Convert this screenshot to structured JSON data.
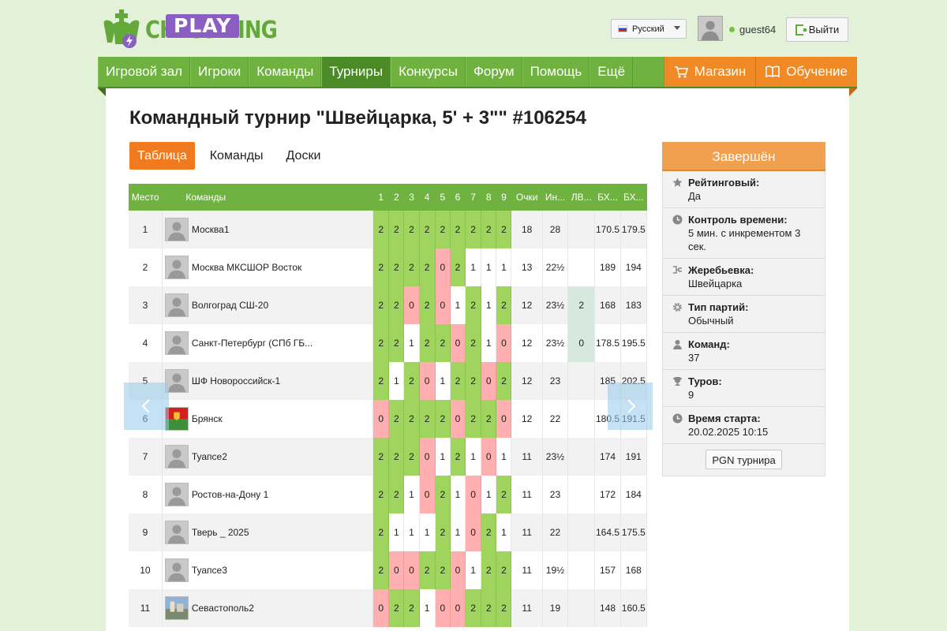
{
  "brand": {
    "name": "CHESS KING",
    "badge": "PLAY"
  },
  "header": {
    "language": "Русский",
    "username": "guest64",
    "logout_label": "Выйти"
  },
  "nav": {
    "items": [
      "Игровой зал",
      "Игроки",
      "Команды",
      "Турниры",
      "Конкурсы",
      "Форум",
      "Помощь",
      "Ещё"
    ],
    "active": "Турниры",
    "shop_label": "Магазин",
    "learn_label": "Обучение"
  },
  "page": {
    "title": "Командный турнир \"Швейцарка, 5' + 3\"\" #106254",
    "tabs": [
      "Таблица",
      "Команды",
      "Доски"
    ],
    "active_tab": "Таблица"
  },
  "table": {
    "headers": {
      "place": "Место",
      "teams": "Команды",
      "rounds": [
        "1",
        "2",
        "3",
        "4",
        "5",
        "6",
        "7",
        "8",
        "9"
      ],
      "points": "Очки",
      "ind": "Ин...",
      "lv": "ЛВ...",
      "bh1": "БХ...",
      "bh2": "БХ..."
    },
    "rows": [
      {
        "place": "1",
        "name": "Москва1",
        "avatar": "default",
        "results": [
          "2",
          "2",
          "2",
          "2",
          "2",
          "2",
          "2",
          "2",
          "2"
        ],
        "points": "18",
        "ind": "28",
        "lv": "",
        "bh1": "170.5",
        "bh2": "179.5"
      },
      {
        "place": "2",
        "name": "Москва МКСШОР Восток",
        "avatar": "default",
        "results": [
          "2",
          "2",
          "2",
          "2",
          "0",
          "2",
          "1",
          "1",
          "1"
        ],
        "points": "13",
        "ind": "22½",
        "lv": "",
        "bh1": "189",
        "bh2": "194"
      },
      {
        "place": "3",
        "name": "Волгоград СШ-20",
        "avatar": "default",
        "results": [
          "2",
          "2",
          "0",
          "2",
          "0",
          "1",
          "2",
          "1",
          "2"
        ],
        "points": "12",
        "ind": "23½",
        "lv": "2",
        "bh1": "168",
        "bh2": "183"
      },
      {
        "place": "4",
        "name": "Санкт-Петербург (СПб ГБ...",
        "avatar": "default",
        "results": [
          "2",
          "2",
          "1",
          "2",
          "2",
          "0",
          "2",
          "1",
          "0"
        ],
        "points": "12",
        "ind": "23½",
        "lv": "0",
        "bh1": "178.5",
        "bh2": "195.5"
      },
      {
        "place": "5",
        "name": "ШФ Новороссийск-1",
        "avatar": "default",
        "results": [
          "2",
          "1",
          "2",
          "0",
          "1",
          "2",
          "2",
          "0",
          "2"
        ],
        "points": "12",
        "ind": "23",
        "lv": "",
        "bh1": "185",
        "bh2": "202.5"
      },
      {
        "place": "6",
        "name": "Брянск",
        "avatar": "flag",
        "results": [
          "0",
          "2",
          "2",
          "2",
          "2",
          "0",
          "2",
          "2",
          "0"
        ],
        "points": "12",
        "ind": "22",
        "lv": "",
        "bh1": "180.5",
        "bh2": "191.5"
      },
      {
        "place": "7",
        "name": "Туапсе2",
        "avatar": "default",
        "results": [
          "2",
          "2",
          "2",
          "0",
          "1",
          "2",
          "1",
          "0",
          "1"
        ],
        "points": "11",
        "ind": "23½",
        "lv": "",
        "bh1": "174",
        "bh2": "191"
      },
      {
        "place": "8",
        "name": "Ростов-на-Дону 1",
        "avatar": "default",
        "results": [
          "2",
          "2",
          "1",
          "0",
          "2",
          "1",
          "0",
          "1",
          "2"
        ],
        "points": "11",
        "ind": "23",
        "lv": "",
        "bh1": "172",
        "bh2": "184"
      },
      {
        "place": "9",
        "name": "Тверь _ 2025",
        "avatar": "default",
        "results": [
          "2",
          "1",
          "1",
          "1",
          "2",
          "1",
          "0",
          "2",
          "1"
        ],
        "points": "11",
        "ind": "22",
        "lv": "",
        "bh1": "164.5",
        "bh2": "175.5"
      },
      {
        "place": "10",
        "name": "Туапсе3",
        "avatar": "default",
        "results": [
          "2",
          "0",
          "0",
          "2",
          "2",
          "0",
          "1",
          "2",
          "2"
        ],
        "points": "11",
        "ind": "19½",
        "lv": "",
        "bh1": "157",
        "bh2": "168"
      },
      {
        "place": "11",
        "name": "Севастополь2",
        "avatar": "photo",
        "results": [
          "0",
          "2",
          "2",
          "1",
          "0",
          "0",
          "2",
          "2",
          "2"
        ],
        "points": "11",
        "ind": "19",
        "lv": "",
        "bh1": "148",
        "bh2": "160.5"
      }
    ]
  },
  "sidebar": {
    "status": "Завершён",
    "items": [
      {
        "icon": "star-icon",
        "label": "Рейтинговый:",
        "value": "Да"
      },
      {
        "icon": "clock-icon",
        "label": "Контроль времени:",
        "value": "5 мин. с инкрементом 3 сек."
      },
      {
        "icon": "bracket-icon",
        "label": "Жеребьевка:",
        "value": "Швейцарка"
      },
      {
        "icon": "gear-icon",
        "label": "Тип партий:",
        "value": "Обычный"
      },
      {
        "icon": "user-icon",
        "label": "Команд:",
        "value": "37"
      },
      {
        "icon": "trophy-icon",
        "label": "Туров:",
        "value": "9"
      },
      {
        "icon": "clock-icon",
        "label": "Время старта:",
        "value": "20.02.2025 10:15"
      }
    ],
    "pgn_label": "PGN турнира"
  },
  "colors": {
    "green": "#6fb23f",
    "orange": "#f07a1d",
    "win": "#9fd45f",
    "loss": "#ffafaf",
    "purple": "#8b5fc1"
  }
}
